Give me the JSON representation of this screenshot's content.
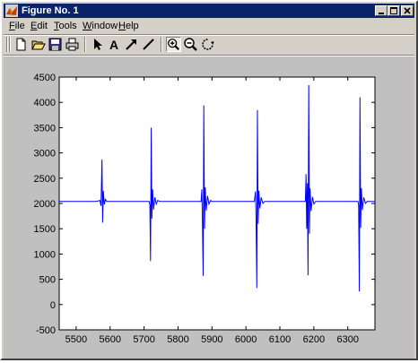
{
  "window": {
    "title": "Figure No. 1",
    "controls": [
      "minimize",
      "maximize",
      "close"
    ]
  },
  "menu": [
    {
      "label": "File",
      "hot": "F",
      "rest": "ile"
    },
    {
      "label": "Edit",
      "hot": "E",
      "rest": "dit"
    },
    {
      "label": "Tools",
      "hot": "T",
      "rest": "ools"
    },
    {
      "label": "Window",
      "hot": "W",
      "rest": "indow"
    },
    {
      "label": "Help",
      "hot": "H",
      "rest": "elp"
    }
  ],
  "toolbar": {
    "text_tool_label": "A",
    "icons": [
      "new-figure-icon",
      "open-file-icon",
      "save-icon",
      "print-icon",
      "select-arrow-icon",
      "text-tool-icon",
      "arrow-tool-icon",
      "line-tool-icon",
      "zoom-in-icon",
      "zoom-out-icon",
      "rotate-3d-icon"
    ]
  },
  "colors": {
    "line": "#0000ff",
    "titlebar": "#0a246a",
    "figure_bg": "#c0c0c0",
    "window_bg": "#d4d0c8"
  },
  "chart_data": {
    "type": "line",
    "title": "",
    "xlabel": "",
    "ylabel": "",
    "xlim": [
      5450,
      6380
    ],
    "ylim": [
      -500,
      4500
    ],
    "xticks": [
      5500,
      5600,
      5700,
      5800,
      5900,
      6000,
      6100,
      6200,
      6300
    ],
    "yticks": [
      -500,
      0,
      500,
      1000,
      1500,
      2000,
      2500,
      3000,
      3500,
      4000,
      4500
    ],
    "grid": false,
    "baseline": 2040,
    "series": [
      {
        "values": [
          [
            5450,
            2040
          ],
          [
            5560,
            2040
          ],
          [
            5570,
            2060
          ],
          [
            5573,
            1950
          ],
          [
            5576,
            2870
          ],
          [
            5578,
            1620
          ],
          [
            5580,
            2250
          ],
          [
            5583,
            1980
          ],
          [
            5586,
            2080
          ],
          [
            5590,
            2040
          ],
          [
            5715,
            2040
          ],
          [
            5717,
            1960
          ],
          [
            5719,
            860
          ],
          [
            5721,
            3500
          ],
          [
            5723,
            1700
          ],
          [
            5725,
            2280
          ],
          [
            5728,
            1880
          ],
          [
            5732,
            2120
          ],
          [
            5736,
            1990
          ],
          [
            5740,
            2060
          ],
          [
            5745,
            2040
          ],
          [
            5868,
            2040
          ],
          [
            5870,
            2280
          ],
          [
            5872,
            1620
          ],
          [
            5874,
            570
          ],
          [
            5876,
            3940
          ],
          [
            5878,
            1500
          ],
          [
            5880,
            2320
          ],
          [
            5883,
            1860
          ],
          [
            5887,
            2150
          ],
          [
            5891,
            1990
          ],
          [
            5896,
            2060
          ],
          [
            5900,
            2040
          ],
          [
            6025,
            2040
          ],
          [
            6028,
            2240
          ],
          [
            6030,
            1700
          ],
          [
            6032,
            330
          ],
          [
            6034,
            3850
          ],
          [
            6036,
            1600
          ],
          [
            6038,
            2250
          ],
          [
            6041,
            1900
          ],
          [
            6045,
            2120
          ],
          [
            6050,
            2000
          ],
          [
            6055,
            2040
          ],
          [
            6175,
            2040
          ],
          [
            6177,
            2580
          ],
          [
            6179,
            1500
          ],
          [
            6181,
            2400
          ],
          [
            6183,
            580
          ],
          [
            6185,
            4340
          ],
          [
            6187,
            1400
          ],
          [
            6189,
            2300
          ],
          [
            6192,
            1850
          ],
          [
            6196,
            2130
          ],
          [
            6200,
            1990
          ],
          [
            6205,
            2040
          ],
          [
            6330,
            2040
          ],
          [
            6332,
            1960
          ],
          [
            6334,
            260
          ],
          [
            6336,
            4100
          ],
          [
            6338,
            1520
          ],
          [
            6340,
            2300
          ],
          [
            6343,
            1870
          ],
          [
            6347,
            2120
          ],
          [
            6352,
            2000
          ],
          [
            6357,
            2040
          ],
          [
            6380,
            2040
          ]
        ]
      }
    ]
  }
}
